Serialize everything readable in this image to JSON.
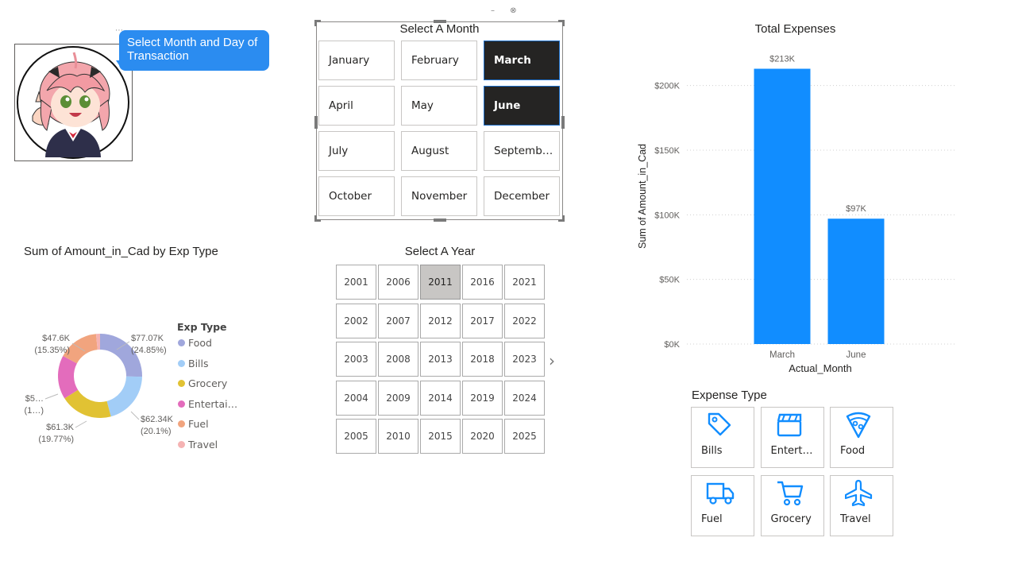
{
  "avatar": {
    "tooltip": "Select Month and Day of Transaction"
  },
  "month_slicer": {
    "title": "Select A Month",
    "months": [
      {
        "label": "January",
        "selected": false
      },
      {
        "label": "February",
        "selected": false
      },
      {
        "label": "March",
        "selected": true
      },
      {
        "label": "April",
        "selected": false
      },
      {
        "label": "May",
        "selected": false
      },
      {
        "label": "June",
        "selected": true
      },
      {
        "label": "July",
        "selected": false
      },
      {
        "label": "August",
        "selected": false
      },
      {
        "label": "Septemb…",
        "selected": false
      },
      {
        "label": "October",
        "selected": false
      },
      {
        "label": "November",
        "selected": false
      },
      {
        "label": "December",
        "selected": false
      }
    ]
  },
  "year_slicer": {
    "title": "Select A Year",
    "rows": [
      [
        "2001",
        "2006",
        "2011",
        "2016",
        "2021"
      ],
      [
        "2002",
        "2007",
        "2012",
        "2017",
        "2022"
      ],
      [
        "2003",
        "2008",
        "2013",
        "2018",
        "2023"
      ],
      [
        "2004",
        "2009",
        "2014",
        "2019",
        "2024"
      ],
      [
        "2005",
        "2010",
        "2015",
        "2020",
        "2025"
      ]
    ],
    "selected": "2011",
    "next_icon": "chevron-right-icon"
  },
  "donut": {
    "title": "Sum of Amount_in_Cad by Exp Type",
    "legend_title": "Exp Type",
    "slices": [
      {
        "label": "Food",
        "value_label": "$77.07K",
        "pct_label": "(24.85%)",
        "pct": 24.85,
        "color": "#a0a7dc"
      },
      {
        "label": "Bills",
        "value_label": "$62.34K",
        "pct_label": "(20.1%)",
        "pct": 20.1,
        "color": "#a2cdf7"
      },
      {
        "label": "Grocery",
        "value_label": "$61.3K",
        "pct_label": "(19.77%)",
        "pct": 19.77,
        "color": "#e1c233"
      },
      {
        "label": "Entertai…",
        "value_label": "$5…",
        "pct_label": "(1…)",
        "pct": 16.5,
        "color": "#e36cbc"
      },
      {
        "label": "Fuel",
        "value_label": "$47.6K",
        "pct_label": "(15.35%)",
        "pct": 15.35,
        "color": "#f1a47e"
      },
      {
        "label": "Travel",
        "value_label": "",
        "pct_label": "",
        "pct": 1.5,
        "color": "#f5b3b3"
      }
    ]
  },
  "chart_data": {
    "type": "bar",
    "title": "Total Expenses",
    "xlabel": "Actual_Month",
    "ylabel": "Sum of Amount_in_Cad",
    "categories": [
      "March",
      "June"
    ],
    "values": [
      213000,
      97000
    ],
    "data_labels": [
      "$213K",
      "$97K"
    ],
    "y_ticks": [
      0,
      50000,
      100000,
      150000,
      200000
    ],
    "y_tick_labels": [
      "$0K",
      "$50K",
      "$100K",
      "$150K",
      "$200K"
    ],
    "ylim": [
      0,
      225000
    ],
    "color": "#118dff",
    "grid": true
  },
  "expense_type": {
    "title": "Expense Type",
    "tiles": [
      {
        "label": "Bills",
        "icon": "tag-icon"
      },
      {
        "label": "Entert…",
        "icon": "clapperboard-icon"
      },
      {
        "label": "Food",
        "icon": "pizza-icon"
      },
      {
        "label": "Fuel",
        "icon": "truck-icon"
      },
      {
        "label": "Grocery",
        "icon": "cart-icon"
      },
      {
        "label": "Travel",
        "icon": "plane-icon"
      }
    ],
    "icon_color": "#118dff"
  }
}
